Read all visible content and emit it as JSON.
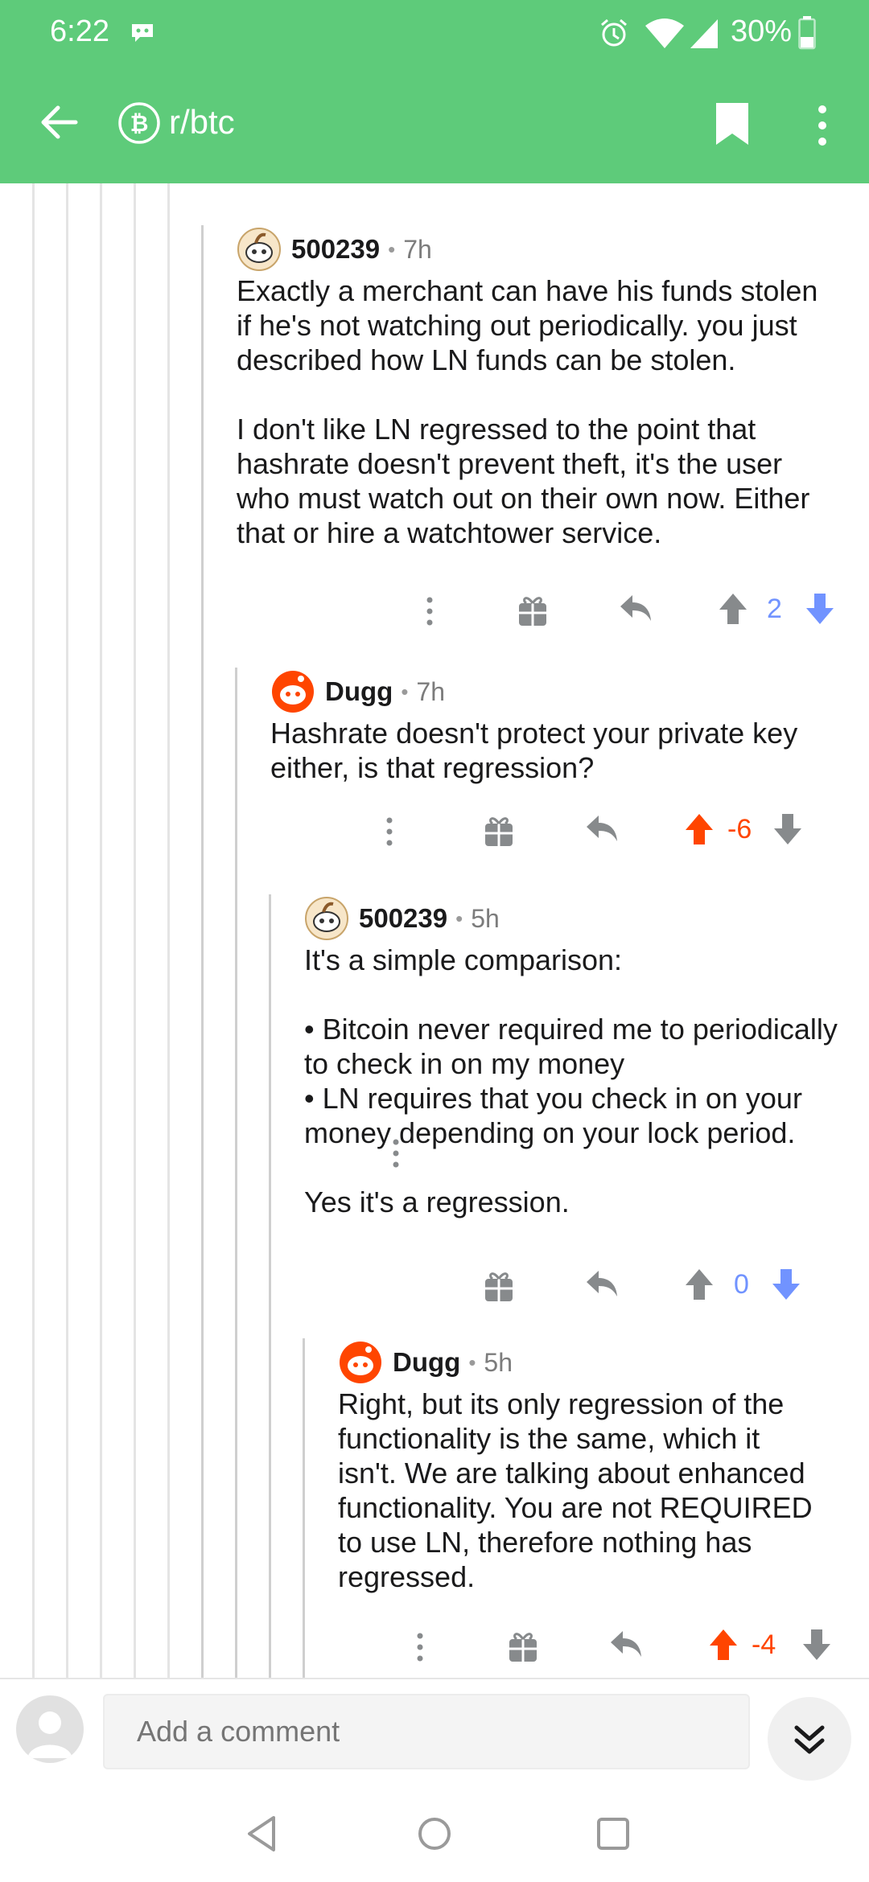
{
  "status_bar": {
    "time": "6:22",
    "battery": "30%",
    "icons": [
      "notification-icon",
      "alarm-icon",
      "wifi-icon",
      "cell-signal-icon",
      "battery-icon"
    ]
  },
  "app_bar": {
    "subreddit": "r/btc",
    "icons": [
      "back-arrow-icon",
      "bitcoin-subreddit-icon",
      "bookmark-icon",
      "more-vertical-icon"
    ]
  },
  "comments": [
    {
      "author": "500239",
      "separator": "•",
      "age": "7h",
      "body": "Exactly a merchant can have his funds stolen\nif he's not watching out periodically. you just\ndescribed how LN funds can be stolen.\n\nI don't like LN regressed to the point that\nhashrate doesn't prevent theft, it's the user\nwho must watch out on their own now. Either\nthat or hire a watchtower service.",
      "score": "2",
      "vote": "down"
    },
    {
      "author": "Dugg",
      "separator": "•",
      "age": "7h",
      "body": "Hashrate doesn't protect your private key\neither, is that regression?",
      "score": "-6",
      "vote": "up"
    },
    {
      "author": "500239",
      "separator": "•",
      "age": "5h",
      "body": "It's a simple comparison:\n\n• Bitcoin never required me to periodically\nto check in on my money\n• LN requires that you check in on your\nmoney depending on your lock period.\n\nYes it's a regression.",
      "score": "0",
      "vote": "down"
    },
    {
      "author": "Dugg",
      "separator": "•",
      "age": "5h",
      "body": "Right, but its only regression of the\nfunctionality is the same, which it\nisn't. We are talking about enhanced\nfunctionality. You are not REQUIRED\nto use LN, therefore nothing has\nregressed.",
      "score": "-4",
      "vote": "up"
    }
  ],
  "composer": {
    "placeholder": "Add a comment"
  },
  "colors": {
    "app_bar": "#5ecb7a",
    "upvote": "#ff4500",
    "downvote": "#7193ff",
    "icon_gray": "#878a8c"
  }
}
